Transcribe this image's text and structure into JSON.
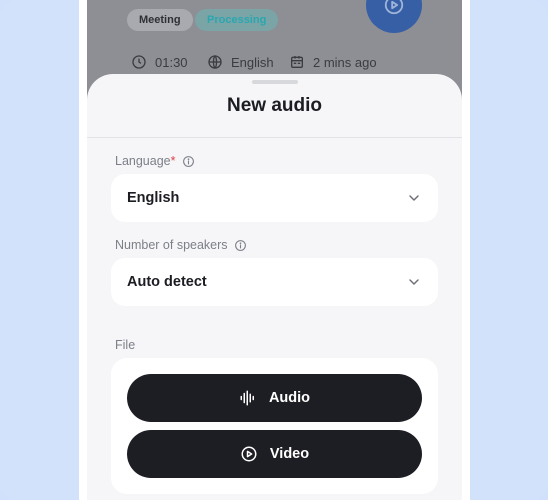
{
  "background_card": {
    "tags": [
      {
        "label": "Meeting"
      },
      {
        "label": "Processing"
      }
    ],
    "meta": {
      "duration": "01:30",
      "language": "English",
      "time_ago": "2 mins ago"
    }
  },
  "sheet": {
    "title": "New audio",
    "language": {
      "label": "Language",
      "required_mark": "*",
      "value": "English"
    },
    "speakers": {
      "label": "Number of speakers",
      "value": "Auto detect"
    },
    "file": {
      "label": "File",
      "audio_button": "Audio",
      "video_button": "Video"
    }
  },
  "colors": {
    "page_background": "#d2e2fa",
    "primary_button": "#1d1e23",
    "required": "#e0404a",
    "processing_tag_text": "#2aa7b0",
    "play_button": "#365fa6"
  }
}
